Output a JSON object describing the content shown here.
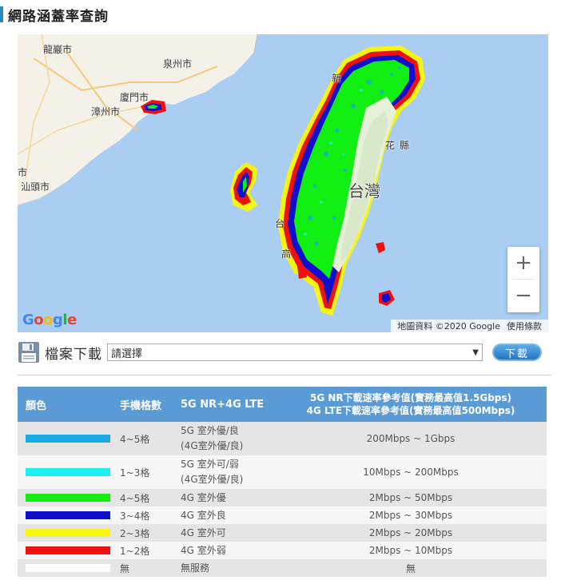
{
  "page": {
    "title": "網路涵蓋率查詢"
  },
  "map": {
    "labels": {
      "longyan": "龍巖市",
      "quanzhou": "泉州市",
      "xiamen": "廈門市",
      "zhangzhou": "漳州市",
      "shantou": "汕頭市",
      "shi_left": "市",
      "taiwan": "台灣",
      "xin": "新",
      "hua": "花",
      "xian": "縣",
      "tai": "台",
      "gao": "高"
    },
    "zoom_in": "+",
    "zoom_out": "−",
    "google": "Google",
    "attribution": {
      "data": "地圖資料 ©2020 Google",
      "terms": "使用條款"
    }
  },
  "download": {
    "label": "檔案下載",
    "select_value": "請選擇",
    "button": "下載"
  },
  "legend": {
    "headers": {
      "color": "顏色",
      "bars": "手機格數",
      "type": "5G NR+4G LTE",
      "speed_line1": "5G NR下載速率參考值(實務最高值1.5Gbps)",
      "speed_line2": "4G LTE下載速率參考值(實務最高值500Mbps)"
    },
    "rows": [
      {
        "color": "#1aa9e0",
        "bars": "4~5格",
        "type1": "5G 室外優/良",
        "type2": "(4G室外優/良)",
        "speed": "200Mbps ~ 1Gbps"
      },
      {
        "color": "#19f2f0",
        "bars": "1~3格",
        "type1": "5G 室外可/弱",
        "type2": "(4G室外優/良)",
        "speed": "10Mbps ~ 200Mbps"
      },
      {
        "color": "#11ee11",
        "bars": "4~5格",
        "type1": "4G 室外優",
        "type2": "",
        "speed": "2Mbps ~ 50Mbps"
      },
      {
        "color": "#1010cc",
        "bars": "3~4格",
        "type1": "4G 室外良",
        "type2": "",
        "speed": "2Mbps ~ 30Mbps"
      },
      {
        "color": "#f5f50f",
        "bars": "2~3格",
        "type1": "4G 室外可",
        "type2": "",
        "speed": "2Mbps ~ 20Mbps"
      },
      {
        "color": "#ee1111",
        "bars": "1~2格",
        "type1": "4G 室外弱",
        "type2": "",
        "speed": "2Mbps ~ 10Mbps"
      },
      {
        "color": "#ffffff",
        "bars": "無",
        "type1": "無服務",
        "type2": "",
        "speed": "無"
      }
    ]
  }
}
